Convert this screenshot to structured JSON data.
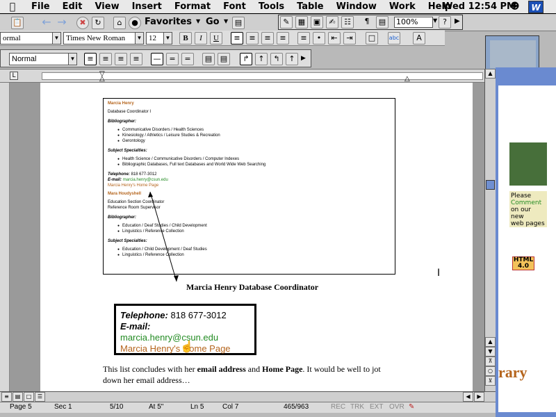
{
  "menubar": {
    "items": [
      "File",
      "Edit",
      "View",
      "Insert",
      "Format",
      "Font",
      "Tools",
      "Table",
      "Window",
      "Work",
      "Help"
    ],
    "clock": "Wed 12:54 PM",
    "app_icon_label": "W"
  },
  "browserbar": {
    "favorites": "Favorites",
    "go": "Go"
  },
  "floatbar": {
    "zoom": "100%"
  },
  "formatting": {
    "style_value": "ormal",
    "font_value": "Times New Roman",
    "size_value": "12",
    "bold": "B",
    "italic": "I",
    "underline": "U"
  },
  "stylebar": {
    "style_value": "Normal"
  },
  "document": {
    "embed": {
      "person1_name": "Marcia Henry",
      "person1_title": "Database Coordinator I",
      "bibliographer_label": "Bibliographer:",
      "person1_bib": [
        "Communicative Disorders / Health Sciences",
        "Kinesiology / Athletics / Leisure Studies & Recreation",
        "Gerontology"
      ],
      "specialties_label": "Subject Specialties:",
      "person1_spec": [
        "Health Science / Communicative Disorders / Computer Indexes",
        "Bibliographic Databases, Full text Databases and World Wide Web Searching"
      ],
      "telephone_label": "Telephone:",
      "telephone_value": "818 677-3012",
      "email_label": "E-mail:",
      "email_value": "marcia.henry@csun.edu",
      "homepage": "Marcia Henry's Home Page",
      "person2_name": "Mara Houdyshell",
      "person2_title1": "Education Section Coordinator",
      "person2_title2": "Reference Room Supervisor",
      "person2_bib": [
        "Education / Deaf Studies / Child Development",
        "Linguistics / Reference Collection"
      ],
      "person2_spec": [
        "Education / Child Development / Deaf Studies",
        "Linguistics / Reference Collection"
      ]
    },
    "caption": "Marcia Henry Database Coordinator",
    "zoom": {
      "telephone_label": "Telephone:",
      "telephone_value": "818 677-3012",
      "email_label": "E-mail:",
      "email_value": "marcia.henry@csun.edu",
      "homepage": "Marcia Henry's Home Page"
    },
    "para_a": "This list concludes with her ",
    "para_b": "email address",
    "para_c": " and ",
    "para_d": "Home Page",
    "para_e": ".  It would be well to jot down her email address…"
  },
  "status": {
    "page": "Page 5",
    "sec": "Sec 1",
    "count": "5/10",
    "at": "At 5\"",
    "ln": "Ln 5",
    "col": "Col 7",
    "words": "465/963",
    "rec": "REC",
    "trk": "TRK",
    "ext": "EXT",
    "ovr": "OVR"
  },
  "bgwin": {
    "note_a": "Please",
    "note_b": "Comment",
    "note_c": "on our new",
    "note_d": "web pages",
    "badge": "HTML 4.0",
    "big": "rary"
  }
}
